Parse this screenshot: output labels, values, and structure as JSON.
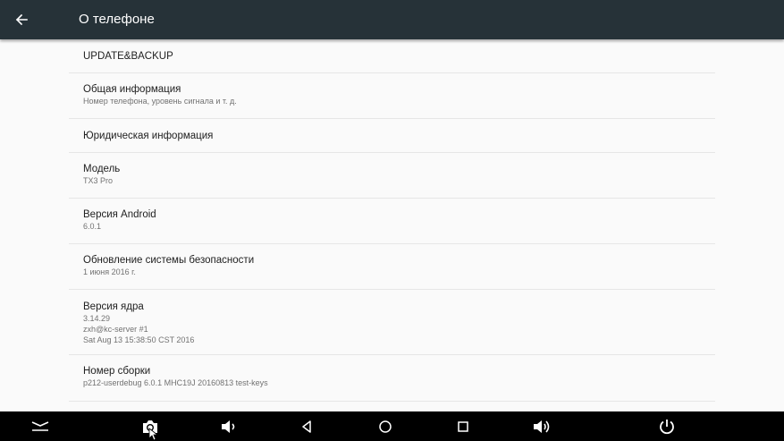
{
  "header": {
    "title": "О телефоне",
    "back_icon": "arrow-back-icon"
  },
  "items": [
    {
      "title": "UPDATE&BACKUP"
    },
    {
      "title": "Общая информация",
      "subtitle": "Номер телефона, уровень сигнала и т. д."
    },
    {
      "title": "Юридическая информация"
    },
    {
      "title": "Модель",
      "subtitle": "TX3 Pro"
    },
    {
      "title": "Версия Android",
      "subtitle": "6.0.1"
    },
    {
      "title": "Обновление системы безопасности",
      "subtitle": "1 июня 2016 г."
    },
    {
      "title": "Версия ядра",
      "subtitle_lines": [
        "3.14.29",
        "zxh@kc-server #1",
        "Sat Aug 13 15:38:50 CST 2016"
      ]
    },
    {
      "title": "Номер сборки",
      "subtitle": "p212-userdebug 6.0.1 MHC19J 20160813 test-keys"
    }
  ],
  "navbar": {
    "buttons": [
      "collapse-icon",
      "screenshot-icon",
      "volume-down-icon",
      "back-icon",
      "home-icon",
      "recents-icon",
      "volume-up-icon",
      "power-icon"
    ]
  },
  "colors": {
    "toolbar": "#263238",
    "background": "#fafafa",
    "navbar": "#000000",
    "divider": "#e6e6e6"
  }
}
